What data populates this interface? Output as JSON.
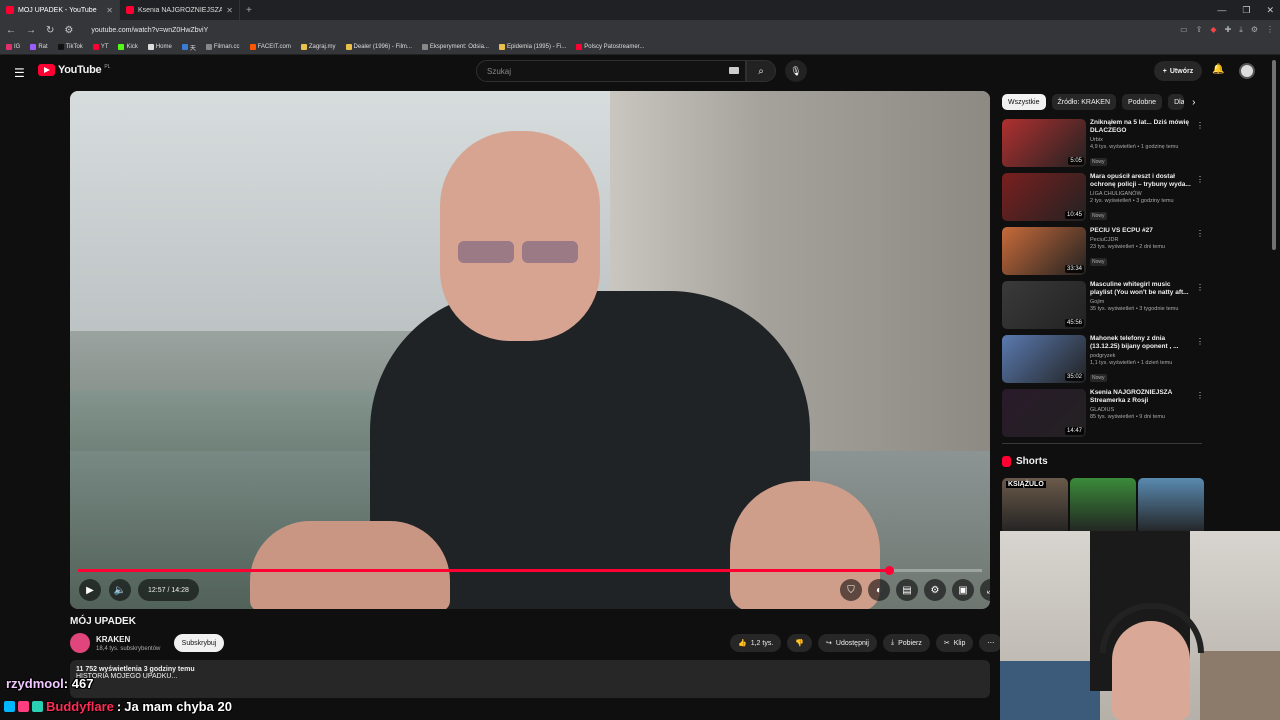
{
  "browser": {
    "tabs": [
      {
        "title": "MÓJ UPADEK - YouTube",
        "active": true
      },
      {
        "title": "Ksenia NAJGROŹNIEJSZA Streamerka",
        "active": false
      }
    ],
    "url": "youtube.com/watch?v=wnZ0HwZbviY",
    "bookmarks": [
      "IG",
      "Rat",
      "TikTok",
      "YT",
      "Kick",
      "Home",
      "天",
      "Filman.cc",
      "FACEIT.com",
      "Zagraj.my",
      "Dealer (1996) - Film...",
      "Eksperyment: Odsia...",
      "Epidemia (1995) - Fi...",
      "Polscy Patostreamer..."
    ]
  },
  "youtube": {
    "logo_text": "YouTube",
    "logo_country": "PL",
    "search_placeholder": "Szukaj",
    "create_label": "Utwórz"
  },
  "player": {
    "time": "12:57 / 14:28",
    "progress": 0.897
  },
  "video": {
    "title": "MÓJ UPADEK",
    "channel": "KRAKEN",
    "subscribers": "18,4 tys. subskrybentów",
    "subscribe_label": "Subskrybuj",
    "likes": "1,2 tys.",
    "share_label": "Udostępnij",
    "download_label": "Pobierz",
    "clip_label": "Klip",
    "views_date": "11 752 wyświetlenia  3 godziny temu",
    "desc_line": "HISTORIA MOJEGO UPADKU..."
  },
  "sidebar": {
    "chips": [
      "Wszystkie",
      "Źródło: KRAKEN",
      "Podobne",
      "Dla"
    ],
    "recs": [
      {
        "title": "Zniknąłem na 5 lat... Dziś mówię DLACZEGO",
        "channel": "Urbix",
        "views": "4,9 tys. wyświetleń • 1 godzinę temu",
        "badge": "Nowy",
        "duration": "5:05",
        "color": "#b03030"
      },
      {
        "title": "Mara opuścił areszt i dostał ochronę policji – trybuny wyda...",
        "channel": "LIGA CHULIGANÓW",
        "views": "2 tys. wyświetleń • 3 godziny temu",
        "badge": "Nowy",
        "duration": "10:45",
        "color": "#7a1f1f"
      },
      {
        "title": "PECIU VS ECPU #27",
        "channel": "PeciuCJDR",
        "views": "23 tys. wyświetleń • 2 dni temu",
        "badge": "Nowy",
        "duration": "33:34",
        "color": "#c86b3a"
      },
      {
        "title": "Masculine whitegirl music playlist (You won't be natty aft...",
        "channel": "Gojim",
        "views": "35 tys. wyświetleń • 3 tygodnie temu",
        "badge": "",
        "duration": "45:56",
        "color": "#3a3a3a"
      },
      {
        "title": "Mahonek telefony z dnia (13.12.25) bijany oponent , ...",
        "channel": "podgryzek",
        "views": "1,1 tys. wyświetleń • 1 dzień temu",
        "badge": "Nowy",
        "duration": "35:02",
        "color": "#5a7ab0"
      },
      {
        "title": "Ksenia NAJGROŹNIEJSZA Streamerka z Rosji",
        "channel": "GLADIUS",
        "views": "85 tys. wyświetleń • 9 dni temu",
        "badge": "",
        "duration": "14:47",
        "color": "#2a1a2a"
      }
    ],
    "shorts_label": "Shorts",
    "shorts": [
      {
        "title": "KSIĄŻULO",
        "color": "#6a5a4a"
      },
      {
        "title": "",
        "color": "#3a8a3a"
      },
      {
        "title": "",
        "color": "#5a8ab0"
      }
    ]
  },
  "chat": [
    {
      "user": "rzydmool",
      "sep": ": ",
      "msg": "467"
    },
    {
      "user": "Buddyflare",
      "sep": ": ",
      "msg": "Ja mam chyba 20"
    }
  ]
}
